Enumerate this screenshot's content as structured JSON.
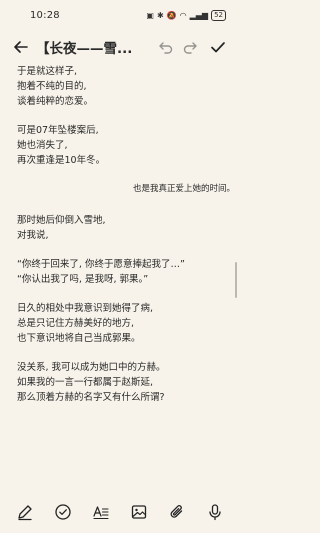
{
  "status_bar": {
    "time": "10:28",
    "battery": "52"
  },
  "toolbar": {
    "title": "【长夜——雪..."
  },
  "content": {
    "paragraphs": [
      [
        "于是就这样子,",
        "抱着不纯的目的,",
        "谈着纯粹的恋爱。"
      ],
      [
        "可是07年坠楼案后,",
        "她也消失了,",
        "再次重逢是10年冬。"
      ],
      [
        "也是我真正爱上她的时间。"
      ],
      [
        "那时她后仰倒入雪地,",
        "对我说,"
      ],
      [
        "“你终于回来了, 你终于愿意捧起我了…”",
        "“你认出我了吗, 是我呀, 郭果。”"
      ],
      [
        "日久的相处中我意识到她得了病,",
        "总是只记住方赫美好的地方,",
        "也下意识地将自己当成郭果。"
      ],
      [
        "没关系, 我可以成为她口中的方赫。",
        "如果我的一言一行都属于赵斯延,",
        "那么顶着方赫的名字又有什么所谓?"
      ]
    ]
  },
  "bottom_bar": {
    "icons": [
      "pen-icon",
      "checklist-icon",
      "text-format-icon",
      "image-icon",
      "attachment-icon",
      "microphone-icon"
    ]
  }
}
